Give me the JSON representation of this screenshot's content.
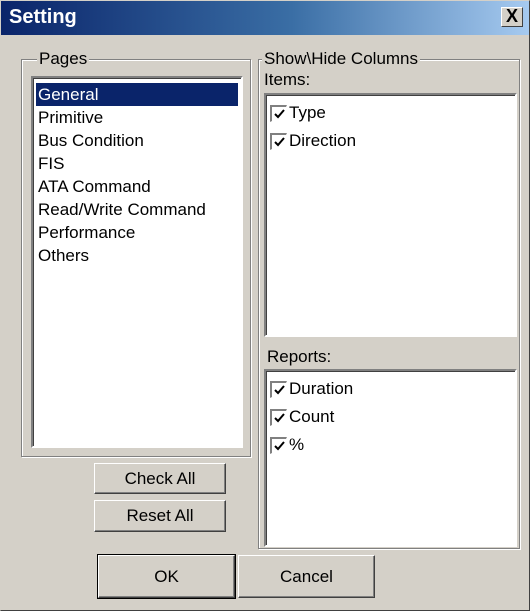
{
  "window": {
    "title": "Setting",
    "close_label": "X"
  },
  "pages": {
    "legend": "Pages",
    "items": [
      {
        "label": "General",
        "selected": true
      },
      {
        "label": "Primitive",
        "selected": false
      },
      {
        "label": "Bus Condition",
        "selected": false
      },
      {
        "label": "FIS",
        "selected": false
      },
      {
        "label": "ATA Command",
        "selected": false
      },
      {
        "label": "Read/Write Command",
        "selected": false
      },
      {
        "label": "Performance",
        "selected": false
      },
      {
        "label": "Others",
        "selected": false
      }
    ]
  },
  "columns": {
    "legend": "Show\\Hide Columns",
    "items_label": "Items:",
    "items": [
      {
        "label": "Type",
        "checked": true
      },
      {
        "label": "Direction",
        "checked": true
      }
    ],
    "reports_label": "Reports:",
    "reports": [
      {
        "label": "Duration",
        "checked": true
      },
      {
        "label": "Count",
        "checked": true
      },
      {
        "label": "%",
        "checked": true
      }
    ]
  },
  "buttons": {
    "check_all": "Check All",
    "reset_all": "Reset All",
    "ok": "OK",
    "cancel": "Cancel"
  },
  "colors": {
    "titlebar_start": "#0a246a",
    "titlebar_end": "#a6caf0",
    "face": "#d4d0c8",
    "selection": "#0a246a"
  }
}
